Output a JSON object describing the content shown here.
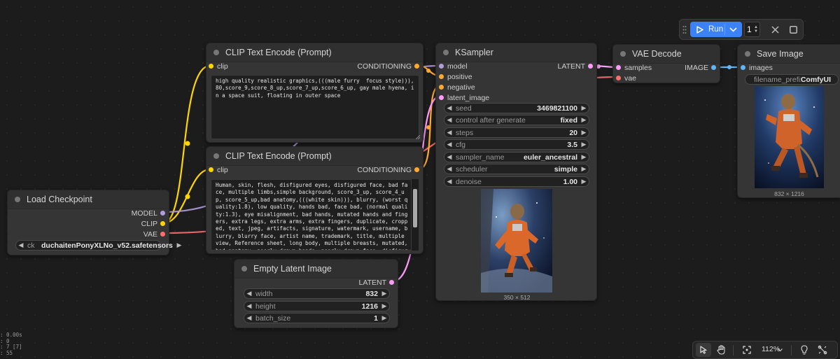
{
  "toolbar": {
    "run_label": "Run",
    "queue_count": "1"
  },
  "nodes": {
    "load_checkpoint": {
      "title": "Load Checkpoint",
      "outputs": [
        "MODEL",
        "CLIP",
        "VAE"
      ],
      "ckpt_label": "ck",
      "ckpt_value": "duchaitenPonyXLNo_v52.safetensors"
    },
    "clip_pos": {
      "title": "CLIP Text Encode (Prompt)",
      "input": "clip",
      "output": "CONDITIONING",
      "text": "high quality realistic graphics,(((male furry  focus style))),80,score_9,score_8_up,score_7_up,score_6_up, gay male hyena, in a space suit, floating in outer space"
    },
    "clip_neg": {
      "title": "CLIP Text Encode (Prompt)",
      "input": "clip",
      "output": "CONDITIONING",
      "text": "Human, skin, flesh, disfigured eyes, disfigured face, bad face, multiple limbs,simple background, score_3_up, score_4_up, score_5_up,bad anatomy,(((white skin))), blurry, (worst quality:1.8), low quality, hands bad, face bad, (normal quality:1.3), eye misalignment, bad hands, mutated hands and fingers, extra legs, extra arms, extra fingers, duplicate, cropped, text, jpeg, artifacts, signature, watermark, username, blurry, blurry face, artist name, trademark, title, multiple view, Reference sheet, long body, multiple breasts, mutated, bad anatomy, poorly drawn hands, poorly drawn face, disfigured, bad proportions, duplicate, bad feet, artist name, ugly, text font ui, missing limb, monochrome, negative_hand, bad_pictures,"
    },
    "empty_latent": {
      "title": "Empty Latent Image",
      "output": "LATENT",
      "width_label": "width",
      "width_value": "832",
      "height_label": "height",
      "height_value": "1216",
      "batch_label": "batch_size",
      "batch_value": "1"
    },
    "ksampler": {
      "title": "KSampler",
      "inputs": [
        "model",
        "positive",
        "negative",
        "latent_image"
      ],
      "output": "LATENT",
      "widgets": [
        {
          "label": "seed",
          "value": "3469821100"
        },
        {
          "label": "control after generate",
          "value": "fixed"
        },
        {
          "label": "steps",
          "value": "20"
        },
        {
          "label": "cfg",
          "value": "3.5"
        },
        {
          "label": "sampler_name",
          "value": "euler_ancestral"
        },
        {
          "label": "scheduler",
          "value": "simple"
        },
        {
          "label": "denoise",
          "value": "1.00"
        }
      ],
      "preview_caption": "350 × 512"
    },
    "vae_decode": {
      "title": "VAE Decode",
      "inputs": [
        "samples",
        "vae"
      ],
      "output": "IMAGE"
    },
    "save_image": {
      "title": "Save Image",
      "input": "images",
      "prefix_label": "filename_prefix",
      "prefix_value": "ComfyUI",
      "preview_caption": "832 × 1216"
    }
  },
  "bottom_bar": {
    "zoom": "112%"
  },
  "stats": [
    ": 0.00s",
    ": 0",
    ": 7 [7]",
    ": 55"
  ],
  "colors": {
    "model": "#b39ddb",
    "clip": "#ffd500",
    "vae": "#ff6e6e",
    "conditioning": "#ffa931",
    "latent": "#ff9cf9",
    "image": "#64b5f6",
    "run_button": "#3b82f6"
  },
  "icons": [
    "play-icon",
    "chevron-down-icon",
    "close-icon",
    "stop-square-icon",
    "drag-handle-icon",
    "pointer-icon",
    "hand-icon",
    "fit-view-icon",
    "lightbulb-icon",
    "link-toggle-icon"
  ]
}
